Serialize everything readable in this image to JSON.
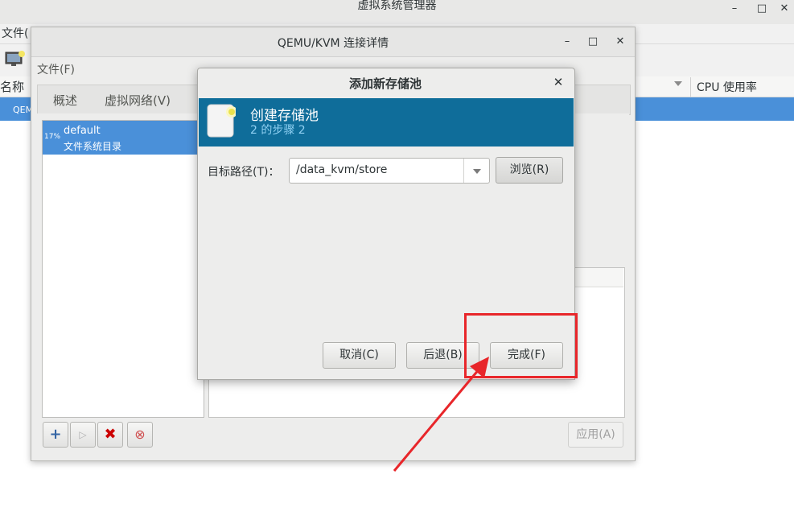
{
  "main_window": {
    "title": "虚拟系统管理器",
    "menu_file": "文件(",
    "header_name": "名称",
    "header_cpu": "CPU 使用率",
    "selected_row_text": "QEM"
  },
  "connection_window": {
    "title": "QEMU/KVM 连接详情",
    "menu_file": "文件(F)",
    "tabs": [
      "概述",
      "虚拟网络(V)"
    ],
    "pool": {
      "percent": "17%",
      "name": "default",
      "type": "文件系统目录"
    },
    "apply_label": "应用(A)"
  },
  "dialog": {
    "title": "添加新存储池",
    "banner_title": "创建存储池",
    "banner_step": "2 的步骤 2",
    "target_path_label": "目标路径(T)：",
    "target_path_value": "/data_kvm/store",
    "browse_label": "浏览(R)",
    "cancel_label": "取消(C)",
    "back_label": "后退(B)",
    "finish_label": "完成(F)"
  },
  "colors": {
    "selection_blue": "#4a90d9",
    "banner_blue": "#0f6d9a",
    "annotation_red": "#e8262a"
  },
  "icons": [
    "minimize-icon",
    "maximize-icon",
    "close-icon",
    "monitor-icon",
    "storage-pool-icon",
    "add-icon",
    "play-icon",
    "delete-icon",
    "stop-icon",
    "dropdown-arrow-icon"
  ]
}
